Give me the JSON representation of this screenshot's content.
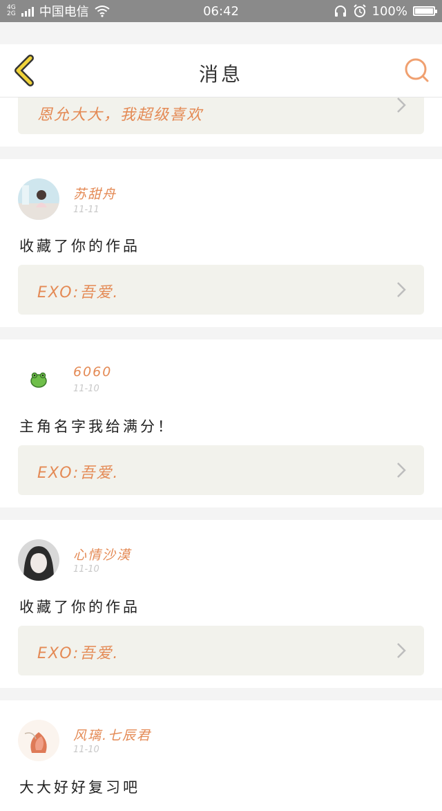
{
  "status_bar": {
    "network_top": "4G",
    "network_bottom": "2G",
    "carrier": "中国电信",
    "time": "06:42",
    "battery": "100%",
    "icons": [
      "signal-icon",
      "wifi-icon",
      "headphones-icon",
      "alarm-icon",
      "battery-icon"
    ]
  },
  "header": {
    "title": "消息",
    "back_icon": "back-chevron-icon",
    "search_icon": "search-icon"
  },
  "colors": {
    "accent": "#e48a55",
    "back_icon": "#f0d33a",
    "ref_bg": "#f2f2ec"
  },
  "top_partial": {
    "ref_text": "恩允大大，我超级喜欢"
  },
  "messages": [
    {
      "user": "苏甜舟",
      "date": "11-11",
      "content": "收藏了你的作品",
      "ref": "EXO:吾爱."
    },
    {
      "user": "6060",
      "date": "11-10",
      "content": "主角名字我给满分！",
      "ref": "EXO:吾爱."
    },
    {
      "user": "心情沙漠",
      "date": "11-10",
      "content": "收藏了你的作品",
      "ref": "EXO:吾爱."
    },
    {
      "user": "风璃.七辰君",
      "date": "11-10",
      "content": "大大好好复习吧"
    }
  ]
}
